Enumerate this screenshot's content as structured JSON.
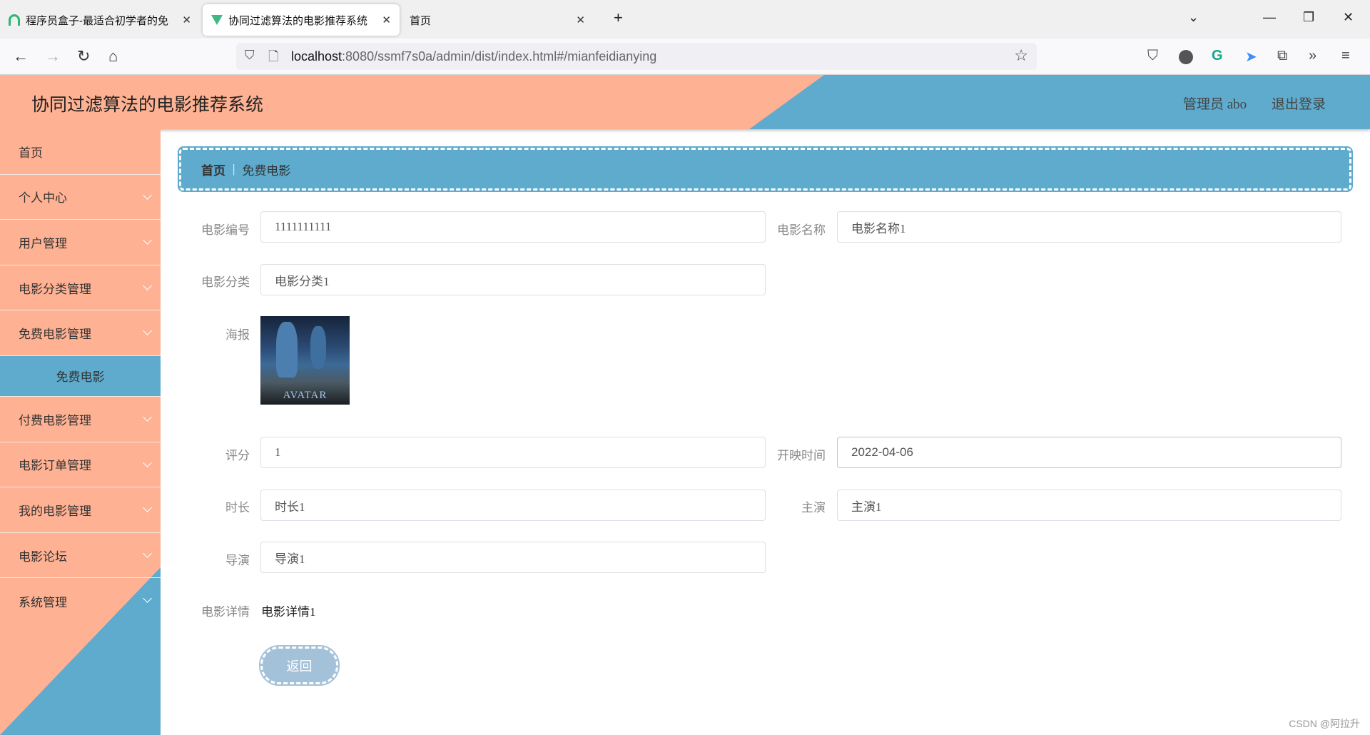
{
  "browser": {
    "tabs": [
      {
        "label": "程序员盒子-最适合初学者的免",
        "active": false
      },
      {
        "label": "协同过滤算法的电影推荐系统",
        "active": true
      },
      {
        "label": "首页",
        "active": false
      }
    ],
    "url_host": "localhost",
    "url_rest": ":8080/ssmf7s0a/admin/dist/index.html#/mianfeidianying"
  },
  "header": {
    "title": "协同过滤算法的电影推荐系统",
    "user": "管理员 abo",
    "logout": "退出登录"
  },
  "colors": {
    "orange": "#ffb293",
    "blue": "#5eabcd",
    "button": "#a3c1d9"
  },
  "sidebar": {
    "items": [
      {
        "label": "首页"
      },
      {
        "label": "个人中心"
      },
      {
        "label": "用户管理"
      },
      {
        "label": "电影分类管理"
      },
      {
        "label": "免费电影管理"
      },
      {
        "label": "免费电影"
      },
      {
        "label": "付费电影管理"
      },
      {
        "label": "电影订单管理"
      },
      {
        "label": "我的电影管理"
      },
      {
        "label": "电影论坛"
      },
      {
        "label": "系统管理"
      }
    ]
  },
  "breadcrumb": {
    "home": "首页",
    "separator": "|",
    "current": "免费电影"
  },
  "form": {
    "movie_no": {
      "label": "电影编号",
      "value": "1111111111"
    },
    "movie_name": {
      "label": "电影名称",
      "value": "电影名称1"
    },
    "category": {
      "label": "电影分类",
      "value": "电影分类1"
    },
    "poster": {
      "label": "海报",
      "logo": "AVATAR"
    },
    "score": {
      "label": "评分",
      "value": "1"
    },
    "release": {
      "label": "开映时间",
      "value": "2022-04-06"
    },
    "duration": {
      "label": "时长",
      "value": "时长1"
    },
    "actor": {
      "label": "主演",
      "value": "主演1"
    },
    "director": {
      "label": "导演",
      "value": "导演1"
    },
    "detail": {
      "label": "电影详情",
      "value": "电影详情1"
    },
    "back": "返回"
  },
  "watermark": "CSDN @阿拉升"
}
